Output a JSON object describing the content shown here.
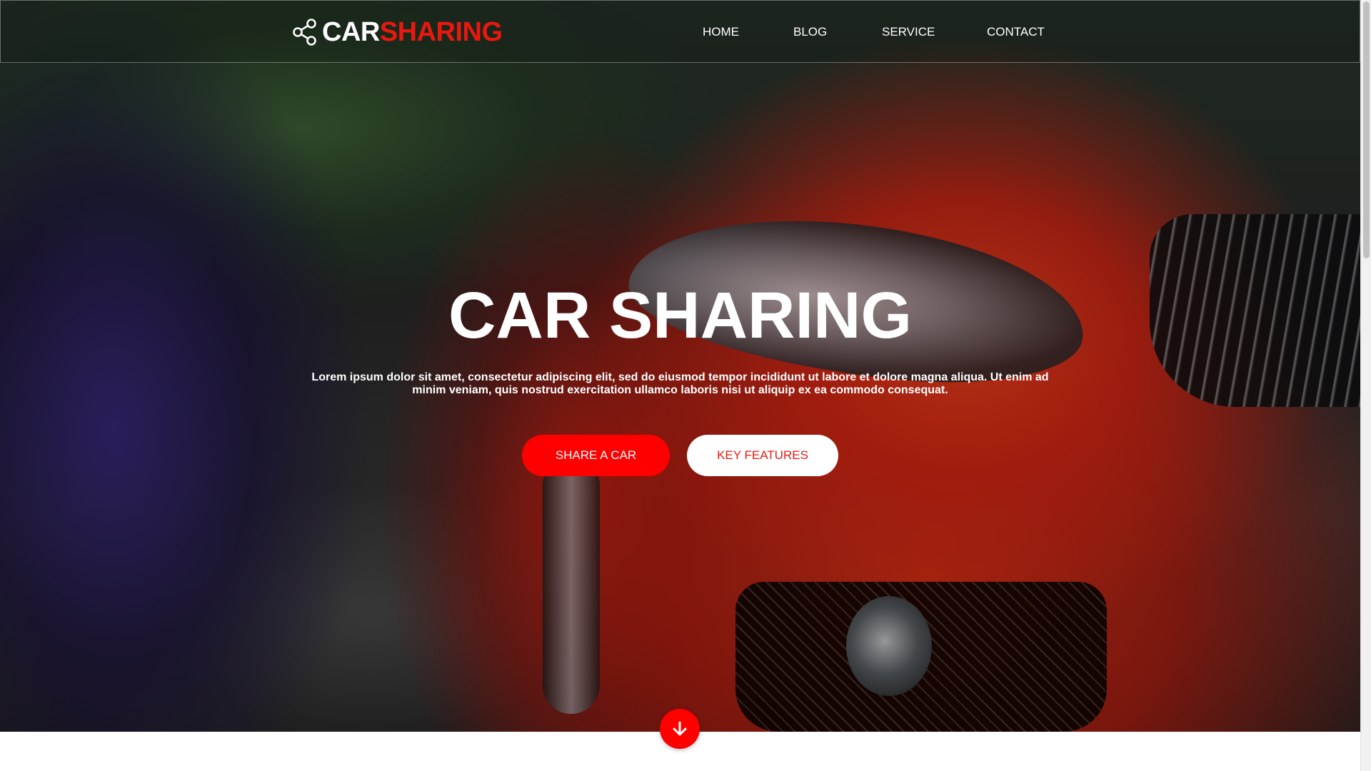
{
  "brand": {
    "logo_part_white": "CAR",
    "logo_part_red": "SHARING",
    "logo_icon": "share-icon"
  },
  "nav": {
    "items": [
      {
        "label": "HOME"
      },
      {
        "label": "BLOG"
      },
      {
        "label": "SERVICE"
      },
      {
        "label": "CONTACT"
      }
    ]
  },
  "hero": {
    "title": "CAR SHARING",
    "subtitle": "Lorem ipsum dolor sit amet, consectetur adipiscing elit, sed do eiusmod tempor incididunt ut labore et dolore magna aliqua. Ut enim ad minim veniam, quis nostrud exercitation ullamco laboris nisi ut aliquip ex ea commodo consequat.",
    "primary_button": "SHARE A CAR",
    "secondary_button": "KEY FEATURES",
    "scroll_icon": "arrow-down-icon"
  },
  "colors": {
    "accent": "#ff0000",
    "brand_red": "#e8180f",
    "text_light": "#ffffff"
  }
}
